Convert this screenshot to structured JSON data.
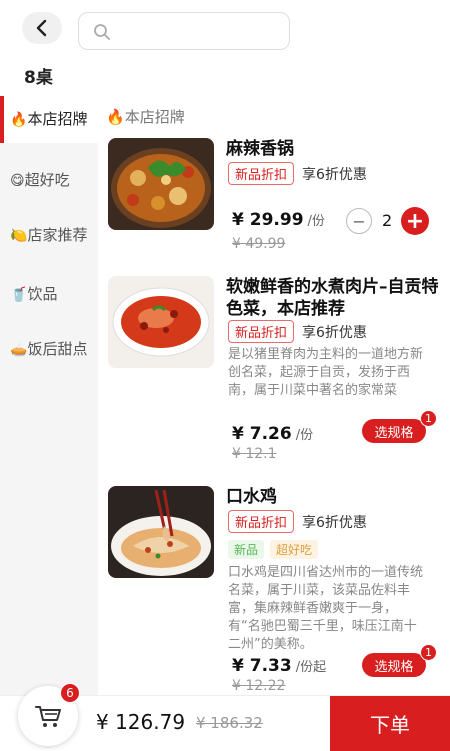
{
  "header": {
    "search_placeholder": "",
    "table_label": "8桌"
  },
  "sidebar": {
    "items": [
      {
        "emoji": "🔥",
        "label": "本店招牌"
      },
      {
        "emoji": "😋",
        "label": "超好吃"
      },
      {
        "emoji": "🍋",
        "label": "店家推荐"
      },
      {
        "emoji": "🥤",
        "label": "饮品"
      },
      {
        "emoji": "🥧",
        "label": "饭后甜点"
      }
    ]
  },
  "main": {
    "category_emoji": "🔥",
    "category_title": "本店招牌",
    "dishes": [
      {
        "name": "麻辣香锅",
        "promo_tag": "新品折扣",
        "promo_text": "享6折优惠",
        "price": "¥ 29.99",
        "unit": "/份",
        "orig_price": "¥ 49.99",
        "minus": "−",
        "qty": "2",
        "plus": "+"
      },
      {
        "name": "软嫩鲜香的水煮肉片–自贡特色菜，本店推荐",
        "promo_tag": "新品折扣",
        "promo_text": "享6折优惠",
        "desc": "是以猪里脊肉为主料的一道地方新创名菜，起源于自贡，发扬于西南，属于川菜中著名的家常菜",
        "price": "¥ 7.26",
        "unit": "/份",
        "orig_price": "¥ 12.1",
        "spec_label": "选规格",
        "spec_badge": "1"
      },
      {
        "name": "口水鸡",
        "promo_tag": "新品折扣",
        "promo_text": "享6折优惠",
        "tags": [
          "新品",
          "超好吃"
        ],
        "desc": "口水鸡是四川省达州市的一道传统名菜，属于川菜，该菜品佐料丰富，集麻辣鲜香嫩爽于一身，有“名驰巴蜀三千里，味压江南十二州”的美称。",
        "price": "¥ 7.33",
        "unit": "/份起",
        "orig_price": "¥ 12.22",
        "spec_label": "选规格",
        "spec_badge": "1"
      }
    ]
  },
  "bottom": {
    "cart_count": "6",
    "total": "¥ 126.79",
    "total_orig": "¥ 186.32",
    "submit_label": "下单"
  },
  "colors": {
    "accent": "#d81e1e"
  }
}
